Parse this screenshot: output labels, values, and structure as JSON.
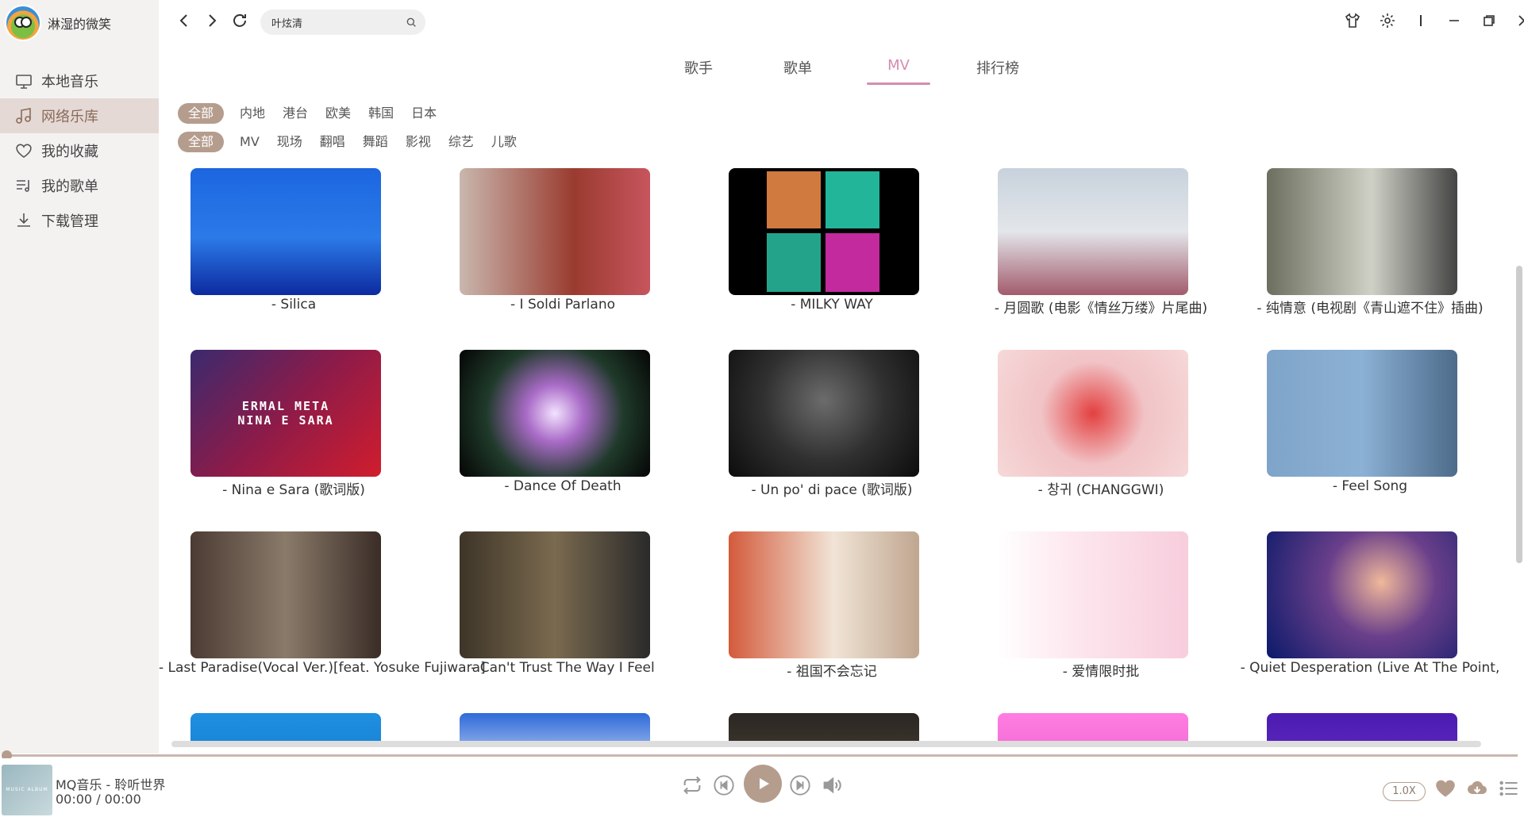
{
  "user": {
    "name": "淋湿的微笑"
  },
  "sidebar": {
    "items": [
      {
        "label": "本地音乐",
        "icon": "monitor-icon"
      },
      {
        "label": "网络乐库",
        "icon": "music-note-icon"
      },
      {
        "label": "我的收藏",
        "icon": "heart-icon"
      },
      {
        "label": "我的歌单",
        "icon": "playlist-icon"
      },
      {
        "label": "下载管理",
        "icon": "download-icon"
      }
    ],
    "active_index": 1
  },
  "search": {
    "value": "叶炫清"
  },
  "tabs": [
    "歌手",
    "歌单",
    "MV",
    "排行榜"
  ],
  "active_tab": "MV",
  "filters": {
    "region": [
      "全部",
      "内地",
      "港台",
      "欧美",
      "韩国",
      "日本"
    ],
    "category": [
      "全部",
      "MV",
      "现场",
      "翻唱",
      "舞蹈",
      "影视",
      "综艺",
      "儿歌"
    ]
  },
  "mv_grid": [
    {
      "caption": "- Silica",
      "thumb_text": ""
    },
    {
      "caption": "- I Soldi Parlano",
      "thumb_text": ""
    },
    {
      "caption": "- MILKY WAY",
      "thumb_text": ""
    },
    {
      "caption": "- 月圆歌 (电影《情丝万缕》片尾曲)",
      "thumb_text": ""
    },
    {
      "caption": "- 纯情意 (电视剧《青山遮不住》插曲)",
      "thumb_text": ""
    },
    {
      "caption": "- Nina e Sara (歌词版)",
      "thumb_text": "ERMAL META\nNINA E SARA"
    },
    {
      "caption": "- Dance Of Death",
      "thumb_text": ""
    },
    {
      "caption": "- Un po' di pace (歌词版)",
      "thumb_text": ""
    },
    {
      "caption": "- 창귀 (CHANGGWI)",
      "thumb_text": ""
    },
    {
      "caption": "- Feel Song",
      "thumb_text": ""
    },
    {
      "caption": "- Last Paradise(Vocal Ver.)[feat. Yosuke Fujiwara]",
      "thumb_text": ""
    },
    {
      "caption": "- Can't Trust The Way I Feel",
      "thumb_text": ""
    },
    {
      "caption": "- 祖国不会忘记",
      "thumb_text": ""
    },
    {
      "caption": "- 爱情限时批",
      "thumb_text": ""
    },
    {
      "caption": "- Quiet Desperation (Live At The Point,",
      "thumb_text": ""
    }
  ],
  "player": {
    "album_text": "MUSIC ALBUM",
    "title": "MQ音乐 - 聆听世界",
    "time": "00:00 / 00:00",
    "speed": "1.0X",
    "progress": 0
  },
  "colors": {
    "accent": "#b59d8e",
    "tab_active": "#d58cb1"
  }
}
